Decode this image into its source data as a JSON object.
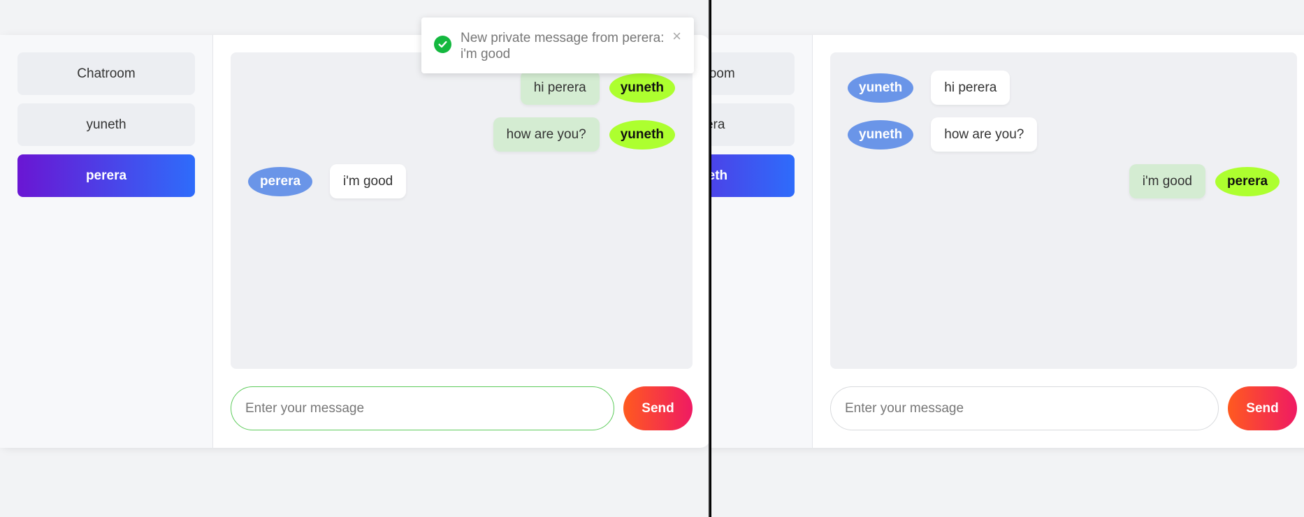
{
  "left_window": {
    "rooms": [
      {
        "label": "Chatroom",
        "active": false
      },
      {
        "label": "yuneth",
        "active": false
      },
      {
        "label": "perera",
        "active": true
      }
    ],
    "messages": [
      {
        "sender": "yuneth",
        "text": "hi perera",
        "mine": true
      },
      {
        "sender": "yuneth",
        "text": "how are you?",
        "mine": true
      },
      {
        "sender": "perera",
        "text": "i'm good",
        "mine": false
      }
    ],
    "input_placeholder": "Enter your message",
    "send_label": "Send"
  },
  "toast": {
    "message": "New private message from perera: i'm good",
    "close_glyph": "×",
    "icon": "check-circle-icon",
    "color": "#14b83f"
  },
  "right_window": {
    "rooms": [
      {
        "label": "Chatroom",
        "active": false
      },
      {
        "label": "perera",
        "active": false
      },
      {
        "label": "yuneth",
        "active": true
      }
    ],
    "messages": [
      {
        "sender": "yuneth",
        "text": "hi perera",
        "mine": false
      },
      {
        "sender": "yuneth",
        "text": "how are you?",
        "mine": false
      },
      {
        "sender": "perera",
        "text": "i'm good",
        "mine": true
      }
    ],
    "input_placeholder": "Enter your message",
    "send_label": "Send"
  },
  "colors": {
    "accent_gradient_start": "#6a16d3",
    "accent_gradient_end": "#2e6cfb",
    "send_gradient_start": "#ff5a1f",
    "send_gradient_end": "#ef1a63",
    "self_avatar": "#adff2f",
    "other_avatar": "#6a95e8",
    "self_bubble": "#d4ecd2"
  }
}
